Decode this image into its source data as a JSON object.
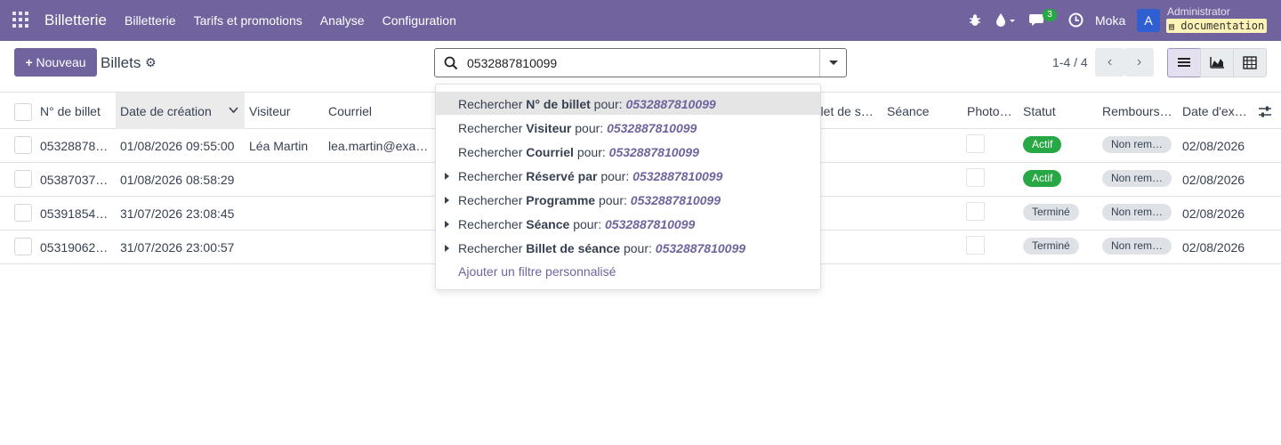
{
  "navbar": {
    "brand": "Billetterie",
    "menu": [
      "Billetterie",
      "Tarifs et promotions",
      "Analyse",
      "Configuration"
    ],
    "chat_count": "3",
    "company": "Moka",
    "avatar_letter": "A",
    "user": "Administrator",
    "database": "documentation",
    "bg_color": "#71639e"
  },
  "control": {
    "new_button": "Nouveau",
    "title": "Billets",
    "search_value": "0532887810099",
    "pager": "1-4 / 4"
  },
  "table": {
    "headers": [
      "N° de billet",
      "Date de création",
      "Visiteur",
      "Courriel",
      "Billet de s…",
      "Séance",
      "Photo…",
      "Statut",
      "Rembours…",
      "Date d'ex…"
    ],
    "rows": [
      {
        "ticket": "05328878…",
        "created": "01/08/2026 09:55:00",
        "visitor": "Léa Martin",
        "email": "lea.martin@exa…",
        "status": "Actif",
        "status_color": "green",
        "refund": "Non rem…",
        "expiry": "02/08/2026"
      },
      {
        "ticket": "05387037…",
        "created": "01/08/2026 08:58:29",
        "visitor": "",
        "email": "",
        "status": "Actif",
        "status_color": "green",
        "refund": "Non rem…",
        "expiry": "02/08/2026"
      },
      {
        "ticket": "05391854…",
        "created": "31/07/2026 23:08:45",
        "visitor": "",
        "email": "",
        "status": "Terminé",
        "status_color": "grey",
        "refund": "Non rem…",
        "expiry": "02/08/2026"
      },
      {
        "ticket": "05319062…",
        "created": "31/07/2026 23:00:57",
        "visitor": "",
        "email": "",
        "status": "Terminé",
        "status_color": "grey",
        "refund": "Non rem…",
        "expiry": "02/08/2026"
      }
    ]
  },
  "dropdown": {
    "prefix": "Rechercher",
    "connector": "pour:",
    "query": "0532887810099",
    "fields": [
      {
        "label": "N° de billet",
        "expandable": false
      },
      {
        "label": "Visiteur",
        "expandable": false
      },
      {
        "label": "Courriel",
        "expandable": false
      },
      {
        "label": "Réservé par",
        "expandable": true
      },
      {
        "label": "Programme",
        "expandable": true
      },
      {
        "label": "Séance",
        "expandable": true
      },
      {
        "label": "Billet de séance",
        "expandable": true
      }
    ],
    "add_filter": "Ajouter un filtre personnalisé"
  }
}
